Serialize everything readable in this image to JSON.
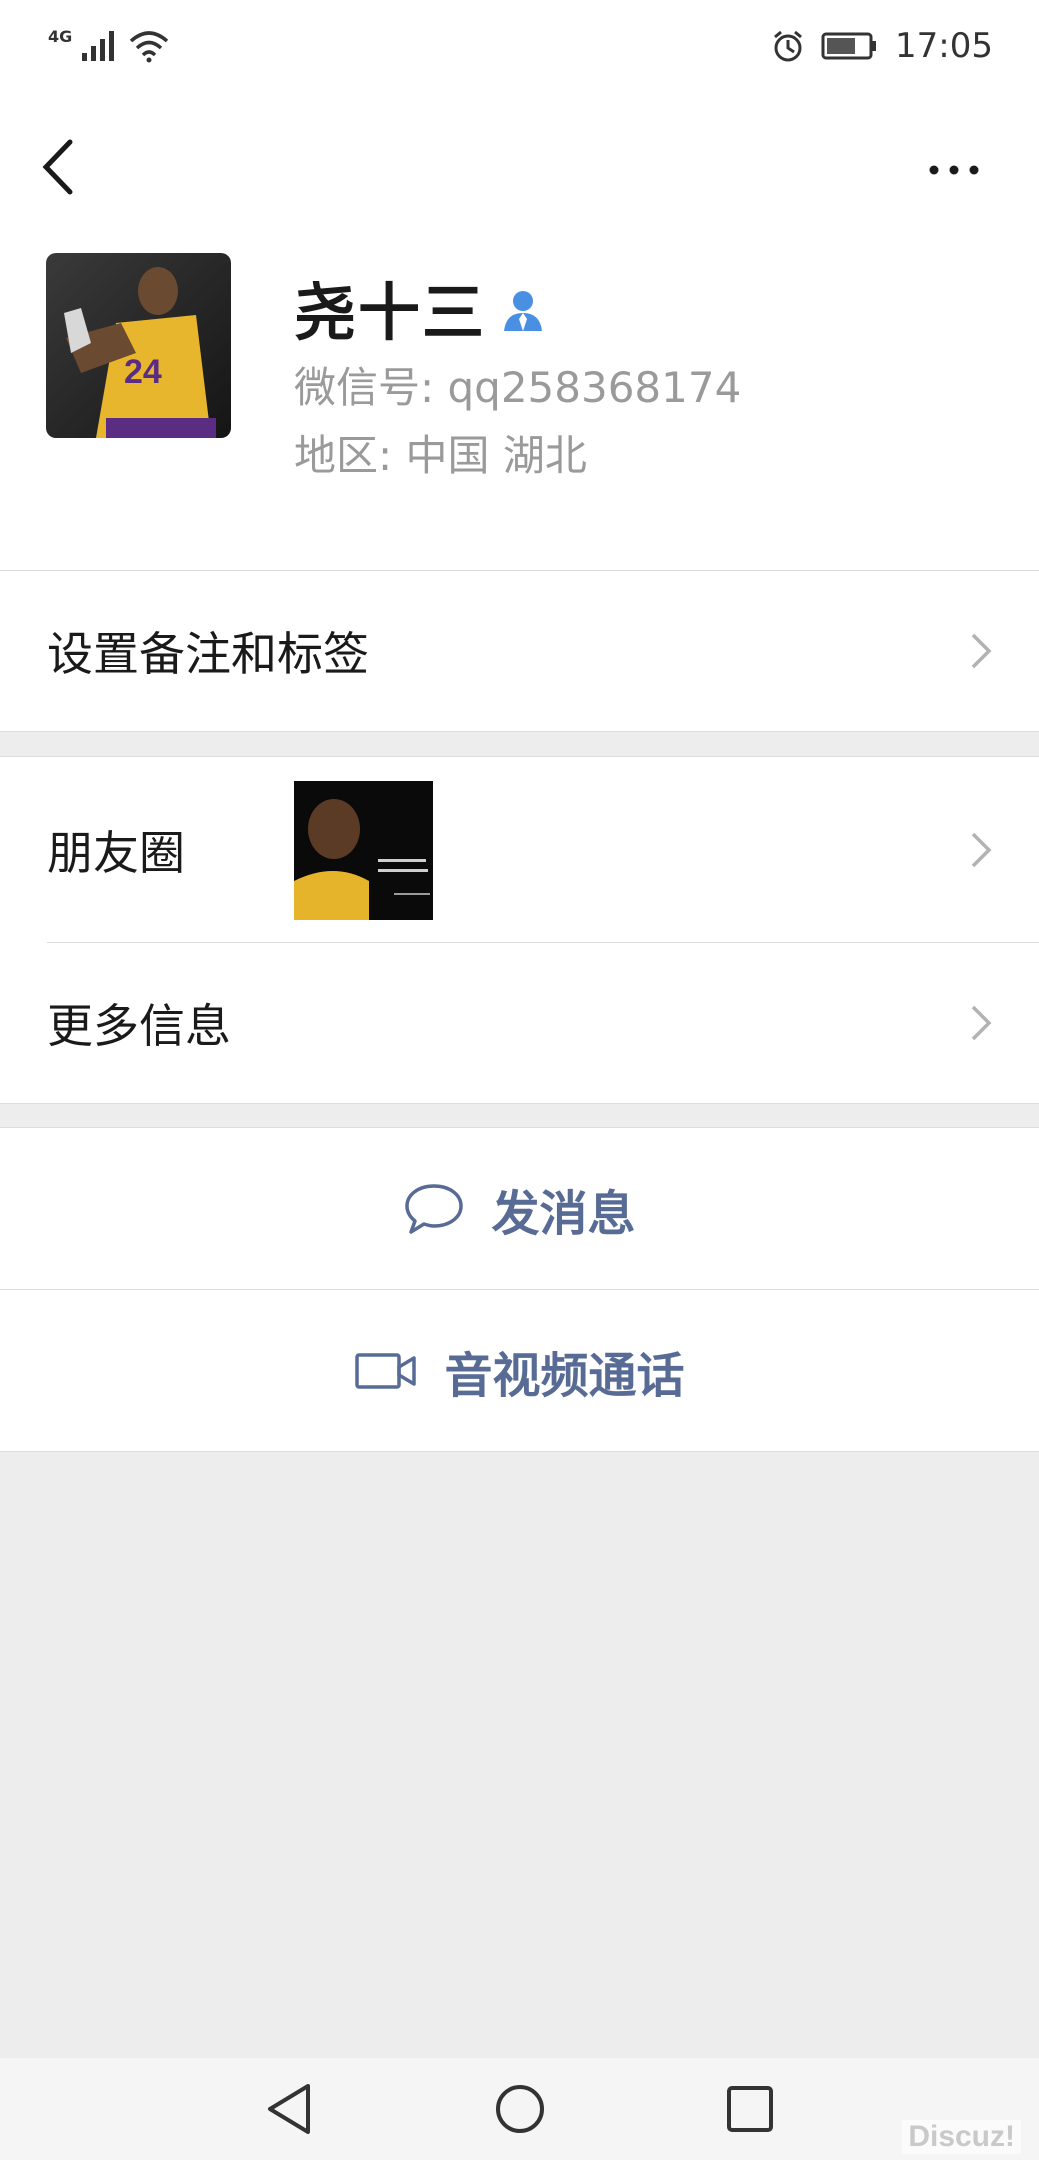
{
  "status_bar": {
    "network": "4G",
    "time": "17:05",
    "icons": [
      "signal-icon",
      "wifi-icon",
      "alarm-icon",
      "battery-icon"
    ]
  },
  "header": {
    "back_icon": "chevron-left-icon",
    "more_icon": "more-dots-icon"
  },
  "profile": {
    "name": "尧十三",
    "wechat_id": "微信号: qq258368174",
    "region": "地区: 中国  湖北"
  },
  "menu": {
    "remarks_label": "设置备注和标签",
    "moments_label": "朋友圈",
    "more_info_label": "更多信息"
  },
  "actions": {
    "send_message": "发消息",
    "video_call": "音视频通话"
  },
  "watermark": "Discuz!",
  "colors": {
    "link": "#576b95",
    "accent_blue": "#4a90e2",
    "background": "#ededed"
  }
}
